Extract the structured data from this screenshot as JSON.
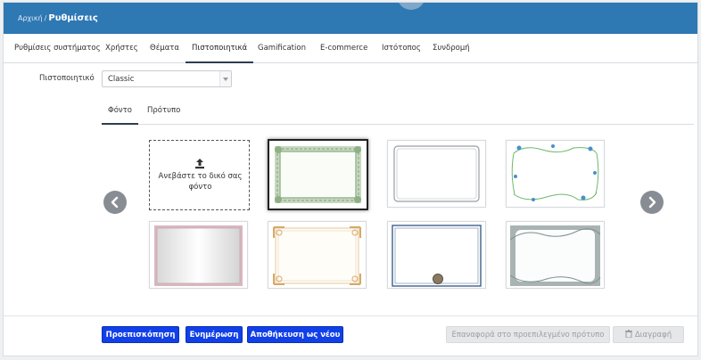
{
  "breadcrumb": {
    "home": "Αρχική",
    "separator": "/",
    "current": "Ρυθμίσεις"
  },
  "tabs": [
    {
      "label": "Ρυθμίσεις συστήματος",
      "active": false
    },
    {
      "label": "Χρήστες",
      "active": false
    },
    {
      "label": "Θέματα",
      "active": false
    },
    {
      "label": "Πιστοποιητικά",
      "active": true
    },
    {
      "label": "Gamification",
      "active": false
    },
    {
      "label": "E-commerce",
      "active": false
    },
    {
      "label": "Ιστότοπος",
      "active": false
    },
    {
      "label": "Συνδρομή",
      "active": false
    }
  ],
  "certificate": {
    "label": "Πιστοποιητικό",
    "selected": "Classic"
  },
  "subtabs": [
    {
      "label": "Φόντο",
      "active": true
    },
    {
      "label": "Πρότυπο",
      "active": false
    }
  ],
  "upload": {
    "icon": "upload-icon",
    "label": "Ανεβάστε το δικό σας φόντο"
  },
  "backgrounds": [
    {
      "name": "green-frame",
      "selected": true
    },
    {
      "name": "grey-frame",
      "selected": false
    },
    {
      "name": "floral-frame",
      "selected": false
    },
    {
      "name": "pink-gradient-frame",
      "selected": false
    },
    {
      "name": "gold-ornate-frame",
      "selected": false
    },
    {
      "name": "blue-seal-frame",
      "selected": false
    },
    {
      "name": "grey-swirl-frame",
      "selected": false
    }
  ],
  "nav": {
    "prev_icon": "chevron-left-icon",
    "next_icon": "chevron-right-icon"
  },
  "buttons": {
    "preview": "Προεπισκόπηση",
    "update": "Ενημέρωση",
    "save_new": "Αποθήκευση ως νέου",
    "reset": "Επαναφορά στο προεπιλεγμένο πρότυπο",
    "delete": "Διαγραφή",
    "delete_icon": "trash-icon"
  },
  "colors": {
    "header": "#2e78b4",
    "primary_button": "#1140e8"
  }
}
